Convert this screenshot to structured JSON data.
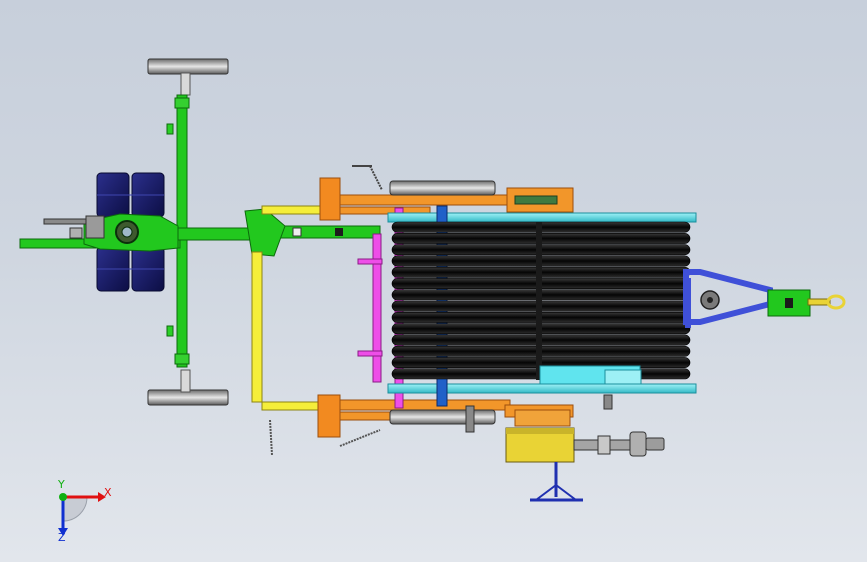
{
  "colors": {
    "frame_green": "#22c81e",
    "frame_green_dark": "#0c6a0c",
    "frame_yellow": "#f5ee3a",
    "frame_orange": "#f2962a",
    "frame_orange_dark": "#9c4e0c",
    "frame_magenta": "#ee4ee8",
    "hose_black": "#0a0a0a",
    "hose_dark": "#2a2a2a",
    "drum_cyan": "#58dce8",
    "drum_cyan_dark": "#1a8e9c",
    "drawbar_blue": "#3f50d8",
    "tank_navy": "#161a6a",
    "gearbox_yellow": "#e9d335",
    "wheel_grey": "#9b9b9b",
    "axis_x": "#e01010",
    "axis_y": "#10b010",
    "axis_z": "#1030d0"
  },
  "axes": {
    "x_label": "X",
    "y_label": "Y",
    "z_label": "Z"
  }
}
